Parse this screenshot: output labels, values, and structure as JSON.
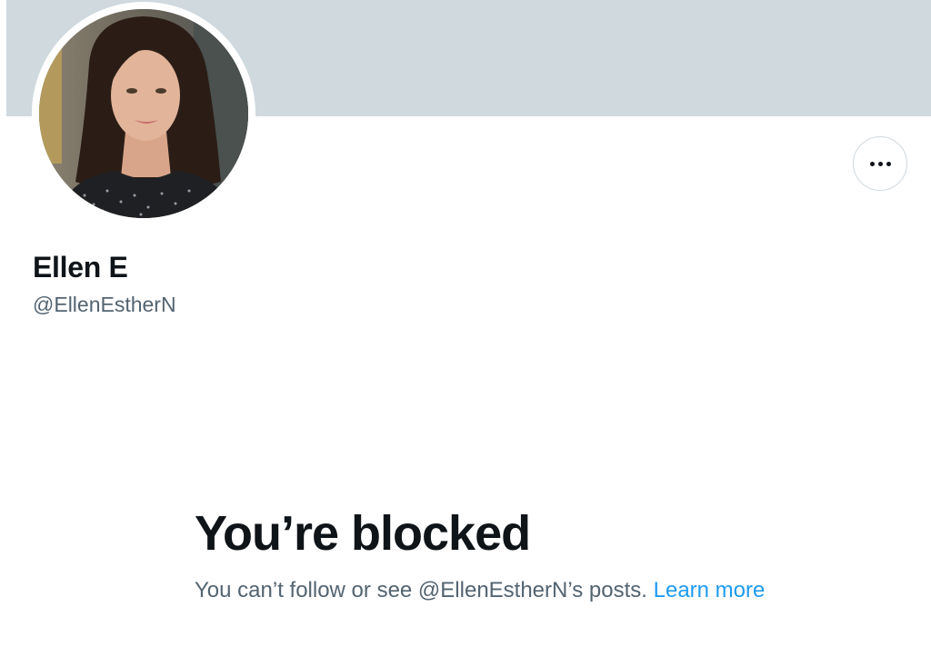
{
  "profile": {
    "display_name": "Ellen E",
    "handle": "@EllenEstherN",
    "avatar_alt": "profile photo"
  },
  "actions": {
    "more_icon": "more-horizontal-icon"
  },
  "blocked": {
    "title": "You’re blocked",
    "message": "You can’t follow or see @EllenEstherN’s posts.",
    "learn_more": "Learn more"
  },
  "colors": {
    "banner": "#cfd9de",
    "text_primary": "#0f1419",
    "text_secondary": "#536471",
    "link": "#1d9bf0"
  }
}
